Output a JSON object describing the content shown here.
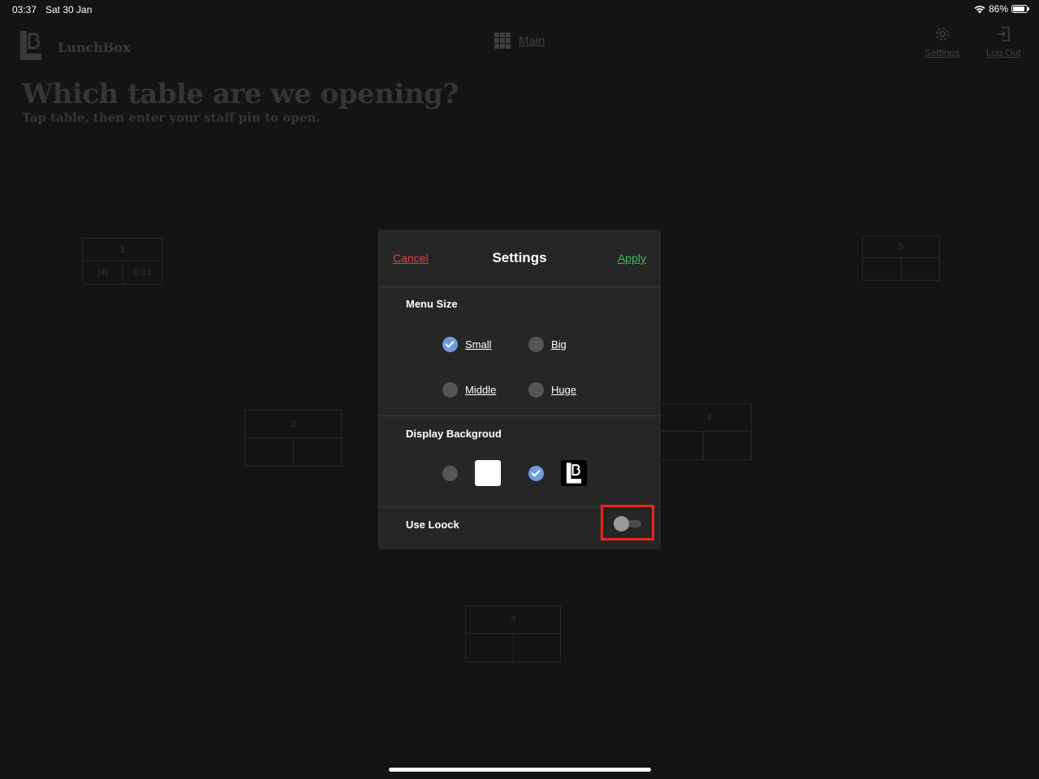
{
  "status_bar": {
    "time": "03:37",
    "date": "Sat 30 Jan",
    "battery": "86%"
  },
  "app": {
    "brand": "LunchBox",
    "nav_main_label": "Main",
    "nav_settings_label": "Settings",
    "nav_logout_label": "Log Out",
    "heading": "Which table are we opening?",
    "subheading": "Tap table, then enter your staff pin to open.",
    "tables": [
      {
        "number": "1",
        "guests": "(4)",
        "time": "0:03"
      },
      {
        "number": "2",
        "guests": "",
        "time": ""
      },
      {
        "number": "3",
        "guests": "",
        "time": ""
      },
      {
        "number": "4",
        "guests": "",
        "time": ""
      },
      {
        "number": "5",
        "guests": "",
        "time": ""
      }
    ]
  },
  "settings_modal": {
    "title": "Settings",
    "cancel_label": "Cancel",
    "apply_label": "Apply",
    "menu_size_label": "Menu Size",
    "menu_size_options": [
      {
        "label": "Small",
        "checked": true
      },
      {
        "label": "Big",
        "checked": false
      },
      {
        "label": "Middle",
        "checked": false
      },
      {
        "label": "Huge",
        "checked": false
      }
    ],
    "display_background_label": "Display Backgroud",
    "background_options": [
      {
        "name": "white",
        "checked": false
      },
      {
        "name": "logo",
        "checked": true
      }
    ],
    "use_lock_label": "Use Loock",
    "use_lock_enabled": false
  },
  "colors": {
    "cancel": "#e0443c",
    "apply": "#3cb85c",
    "radio_checked": "#6f9bdc",
    "highlight": "#e8261b"
  }
}
